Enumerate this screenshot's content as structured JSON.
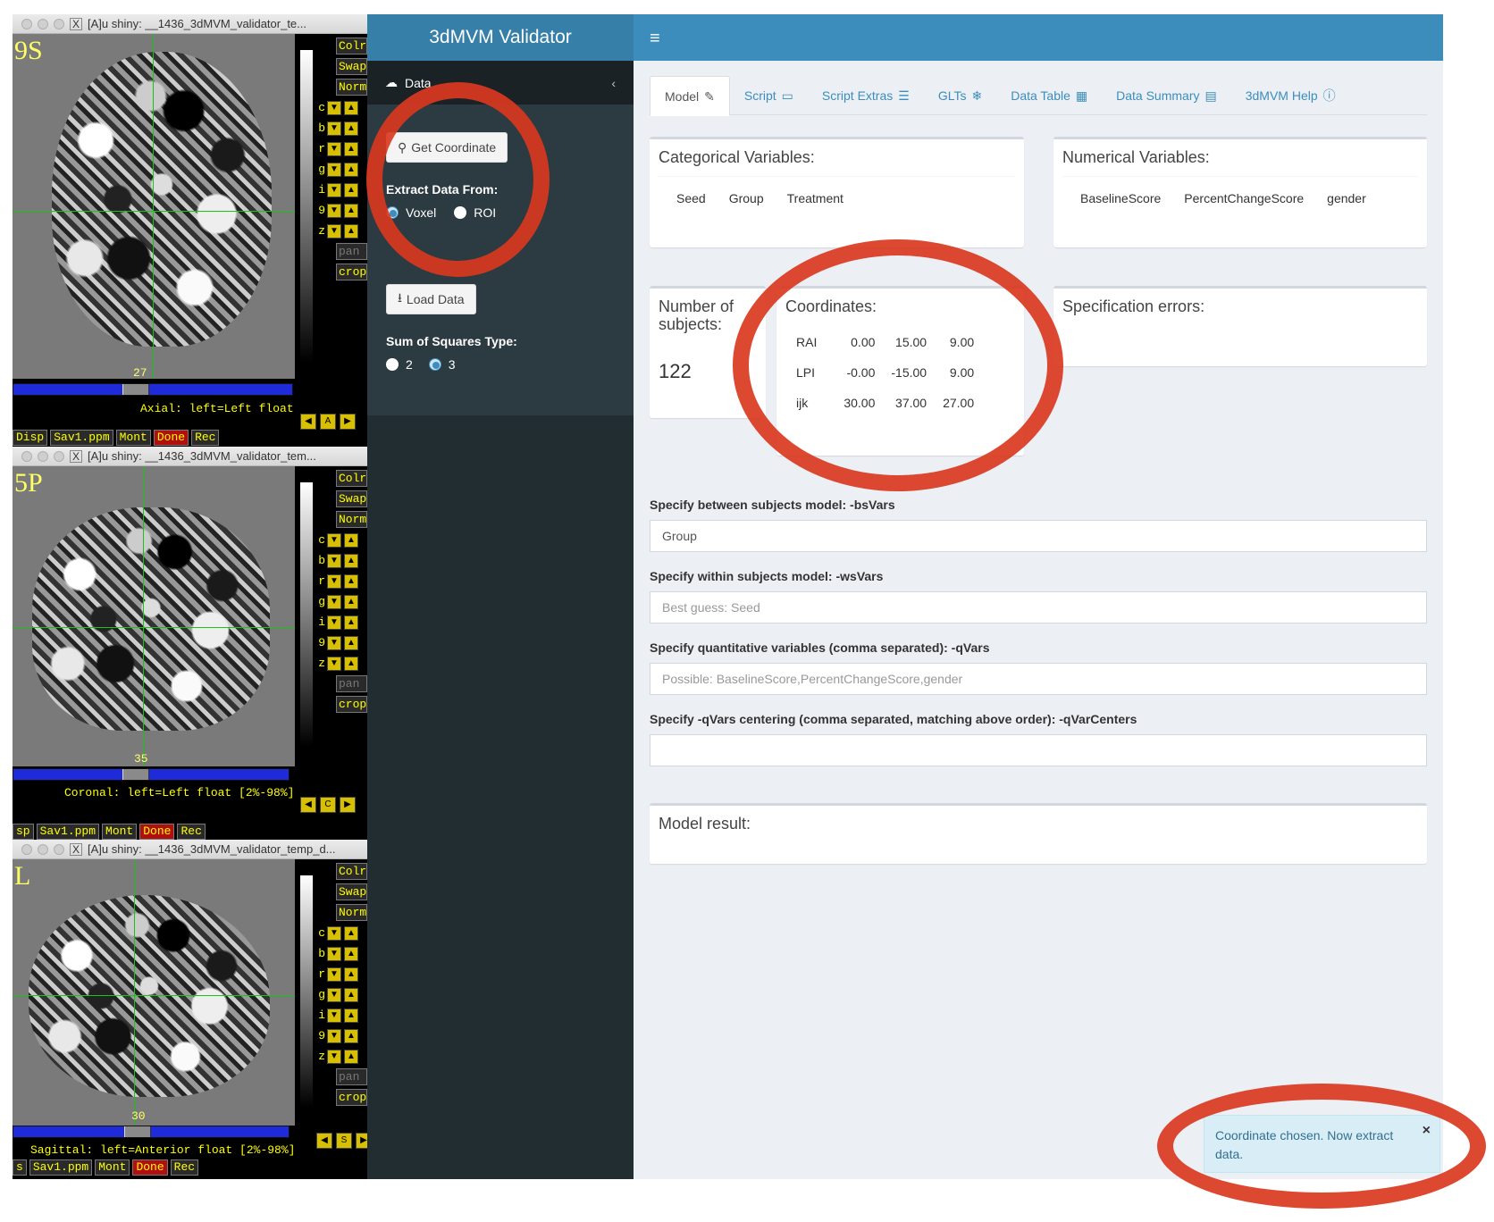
{
  "afni_windows": [
    {
      "title": "[A]u shiny: __1436_3dMVM_validator_te...",
      "corner_label": "9S",
      "slice_number": "27",
      "orientation_info": "Axial: left=Left float",
      "view_button": "A",
      "bottom_buttons": [
        "Disp",
        "Sav1.ppm",
        "Mont",
        "Done",
        "Rec"
      ]
    },
    {
      "title": "[A]u shiny: __1436_3dMVM_validator_tem...",
      "corner_label": "5P",
      "slice_number": "35",
      "orientation_info": "Coronal: left=Left float [2%-98%]",
      "view_button": "C",
      "bottom_buttons": [
        "sp",
        "Sav1.ppm",
        "Mont",
        "Done",
        "Rec"
      ]
    },
    {
      "title": "[A]u shiny: __1436_3dMVM_validator_temp_d...",
      "corner_label": "L",
      "slice_number": "30",
      "orientation_info": "Sagittal: left=Anterior float [2%-98%]",
      "view_button": "S",
      "bottom_buttons": [
        "s",
        "Sav1.ppm",
        "Mont",
        "Done",
        "Rec"
      ]
    }
  ],
  "afni_side_buttons": {
    "top": [
      "Colr",
      "Swap",
      "Norm"
    ],
    "rows": [
      "c",
      "b",
      "r",
      "g",
      "i",
      "9",
      "z"
    ],
    "bottom": [
      "pan",
      "crop"
    ]
  },
  "app": {
    "title": "3dMVM Validator",
    "sidebar": {
      "menu_label": "Data",
      "get_coordinate_label": "Get Coordinate",
      "extract_label": "Extract Data From:",
      "extract_options": [
        "Voxel",
        "ROI"
      ],
      "extract_selected": "Voxel",
      "load_data_label": "Load Data",
      "ss_label": "Sum of Squares Type:",
      "ss_options": [
        "2",
        "3"
      ],
      "ss_selected": "3"
    },
    "tabs": [
      {
        "label": "Model",
        "icon": "edit-icon"
      },
      {
        "label": "Script",
        "icon": "code-icon"
      },
      {
        "label": "Script Extras",
        "icon": "list-icon"
      },
      {
        "label": "GLTs",
        "icon": "snowflake-icon"
      },
      {
        "label": "Data Table",
        "icon": "table-icon"
      },
      {
        "label": "Data Summary",
        "icon": "calculator-icon"
      },
      {
        "label": "3dMVM Help",
        "icon": "question-icon"
      }
    ],
    "categorical": {
      "title": "Categorical Variables:",
      "items": [
        "Seed",
        "Group",
        "Treatment"
      ]
    },
    "numerical": {
      "title": "Numerical Variables:",
      "items": [
        "BaselineScore",
        "PercentChangeScore",
        "gender"
      ]
    },
    "subjects": {
      "title": "Number of subjects:",
      "value": "122"
    },
    "coordinates": {
      "title": "Coordinates:",
      "rows": [
        [
          "RAI",
          "0.00",
          "15.00",
          "9.00"
        ],
        [
          "LPI",
          "-0.00",
          "-15.00",
          "9.00"
        ],
        [
          "ijk",
          "30.00",
          "37.00",
          "27.00"
        ]
      ]
    },
    "spec_errors": {
      "title": "Specification errors:"
    },
    "form": {
      "bs_label": "Specify between subjects model: -bsVars",
      "bs_value": "Group",
      "ws_label": "Specify within subjects model: -wsVars",
      "ws_placeholder": "Best guess: Seed",
      "q_label": "Specify quantitative variables (comma separated): -qVars",
      "q_placeholder": "Possible: BaselineScore,PercentChangeScore,gender",
      "qc_label": "Specify -qVars centering (comma separated, matching above order): -qVarCenters",
      "qc_value": ""
    },
    "model_result": {
      "title": "Model result:"
    },
    "notification": "Coordinate chosen. Now extract data."
  },
  "colors": {
    "header_blue": "#3c8dbc",
    "logo_blue": "#367fa9",
    "sidebar_dark": "#222d32",
    "annotation_red": "#d9381e"
  }
}
